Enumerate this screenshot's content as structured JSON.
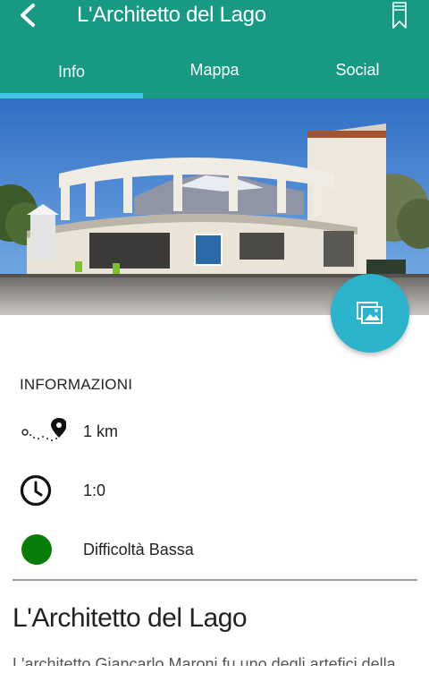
{
  "header": {
    "title": "L'Architetto del Lago",
    "back_icon": "chevron-left-icon",
    "bookmark_icon": "bookmark-icon",
    "background_color": "#189a82"
  },
  "tabs": [
    {
      "label": "Info",
      "active": true
    },
    {
      "label": "Mappa",
      "active": false
    },
    {
      "label": "Social",
      "active": false
    }
  ],
  "tab_indicator_color": "#3ec6e0",
  "hero": {
    "icon": "photo-gallery-icon",
    "fab_color": "#2bb3cc"
  },
  "info": {
    "section_label": "INFORMAZIONI",
    "distance": "1 km",
    "duration": "1:0",
    "difficulty": "Difficoltà Bassa",
    "difficulty_color": "#087d08"
  },
  "content": {
    "title": "L'Architetto del Lago",
    "description": "L'architetto Giancarlo Maroni fu uno degli artefici della"
  }
}
